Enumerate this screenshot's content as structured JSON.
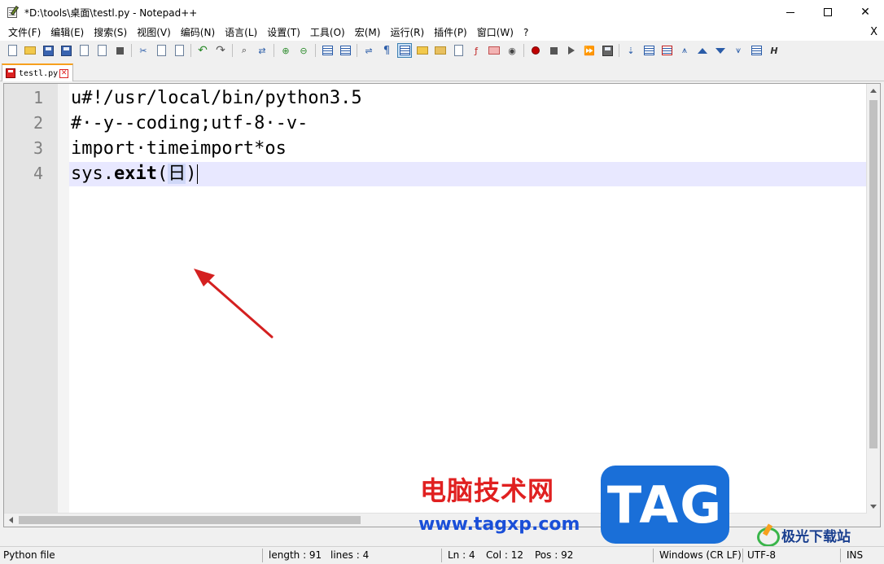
{
  "window": {
    "title": "*D:\\tools\\桌面\\testl.py - Notepad++",
    "controls": {
      "minimize": "—",
      "maximize": "□",
      "close": "✕"
    }
  },
  "menu": {
    "items": [
      "文件(F)",
      "编辑(E)",
      "搜索(S)",
      "视图(V)",
      "编码(N)",
      "语言(L)",
      "设置(T)",
      "工具(O)",
      "宏(M)",
      "运行(R)",
      "插件(P)",
      "窗口(W)",
      "?"
    ],
    "close": "X"
  },
  "toolbar": {
    "icons": [
      "new-file-icon",
      "open-file-icon",
      "save-icon",
      "save-all-icon",
      "close-icon",
      "close-all-icon",
      "print-icon",
      "cut-icon",
      "copy-icon",
      "paste-icon",
      "undo-icon",
      "redo-icon",
      "find-icon",
      "replace-icon",
      "zoom-in-icon",
      "zoom-out-icon",
      "sync-v-icon",
      "sync-h-icon",
      "word-wrap-icon",
      "show-all-chars-icon",
      "indent-guide-icon",
      "udl-icon",
      "doc-map-icon",
      "doc-list-icon",
      "function-list-icon",
      "folder-workspace-icon",
      "monitoring-icon",
      "macro-record-icon",
      "macro-stop-icon",
      "macro-play-icon",
      "macro-run-multi-icon",
      "macro-save-icon",
      "compare-icon",
      "next-diff-icon",
      "prev-diff-icon",
      "first-diff-icon",
      "up-icon",
      "down-icon",
      "last-diff-icon",
      "panel-icon",
      "header-icon"
    ],
    "active_icon": "indent-guide-icon"
  },
  "tabs": [
    {
      "label": "testl.py",
      "close": "✕",
      "modified": true
    }
  ],
  "editor": {
    "line_numbers": [
      "1",
      "2",
      "3",
      "4"
    ],
    "lines": [
      "u#!/usr/local/bin/python3.5",
      "#·-y--coding;utf-8·-v-",
      "import·timeimport*os"
    ],
    "line4": {
      "prefix": "sys.",
      "keyword": "exit",
      "open": "(",
      "inner": "日",
      "close": ")"
    },
    "current_line": 4
  },
  "watermark": {
    "cn_text": "电脑技术网",
    "url": "www.tagxp.com",
    "tag": "TAG",
    "site2": "极光下载站"
  },
  "status": {
    "file_type": "Python file",
    "length": "length : 91",
    "lines": "lines : 4",
    "ln": "Ln : 4",
    "col": "Col : 12",
    "pos": "Pos : 92",
    "eol": "Windows (CR LF)",
    "encoding": "UTF-8",
    "mode": "INS"
  },
  "colors": {
    "current_line": "#e8e8ff",
    "tab_accent": "#f7a01e",
    "annotation_arrow": "#d42020",
    "watermark_red": "#e02020",
    "watermark_blue": "#1a6fd8"
  }
}
